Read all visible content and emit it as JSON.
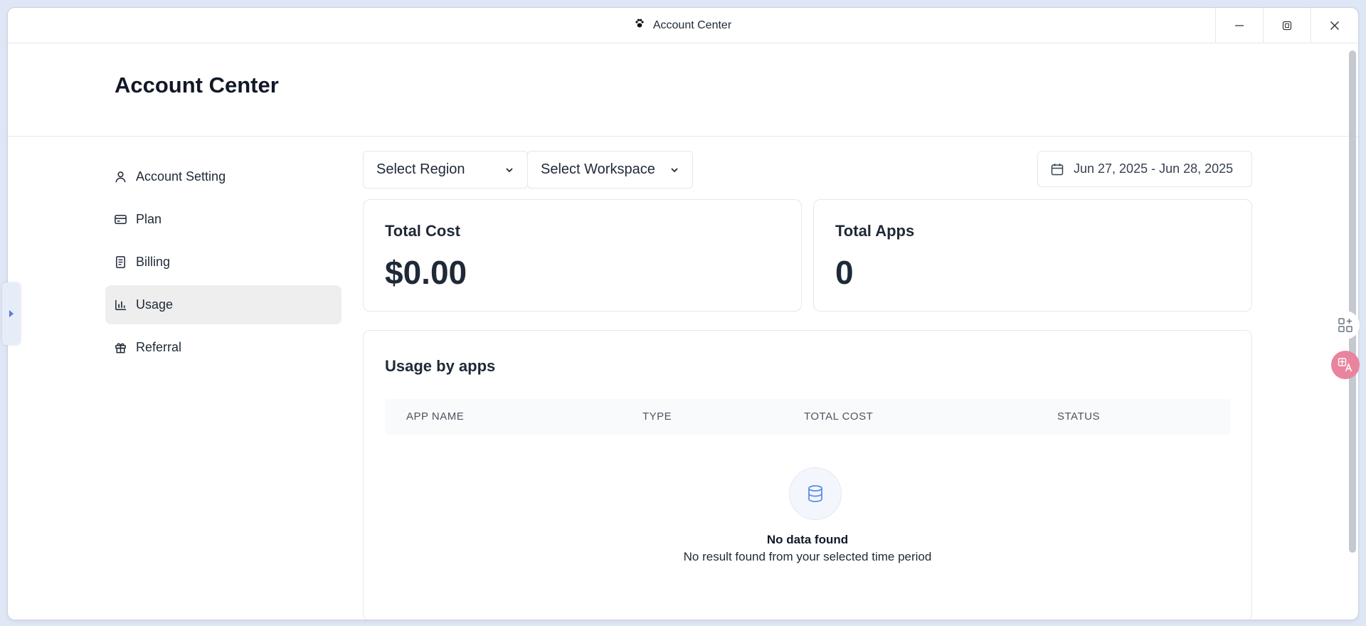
{
  "window": {
    "title": "Account Center"
  },
  "page": {
    "heading": "Account Center"
  },
  "sidebar": {
    "items": [
      {
        "label": "Account Setting",
        "icon": "user-icon"
      },
      {
        "label": "Plan",
        "icon": "credit-card-icon"
      },
      {
        "label": "Billing",
        "icon": "receipt-icon"
      },
      {
        "label": "Usage",
        "icon": "bar-chart-icon",
        "active": true
      },
      {
        "label": "Referral",
        "icon": "gift-icon"
      }
    ]
  },
  "filters": {
    "region": "Select Region",
    "workspace": "Select Workspace",
    "date_range": "Jun 27, 2025 - Jun 28, 2025"
  },
  "cards": {
    "total_cost": {
      "label": "Total Cost",
      "value": "$0.00"
    },
    "total_apps": {
      "label": "Total Apps",
      "value": "0"
    }
  },
  "usage": {
    "title": "Usage by apps",
    "columns": [
      "APP NAME",
      "TYPE",
      "TOTAL COST",
      "STATUS"
    ],
    "empty_title": "No data found",
    "empty_desc": "No result found from your selected time period"
  },
  "colors": {
    "accent": "#3b82f6",
    "active_bg": "#eeeeee",
    "background": "#dfe6f5"
  }
}
